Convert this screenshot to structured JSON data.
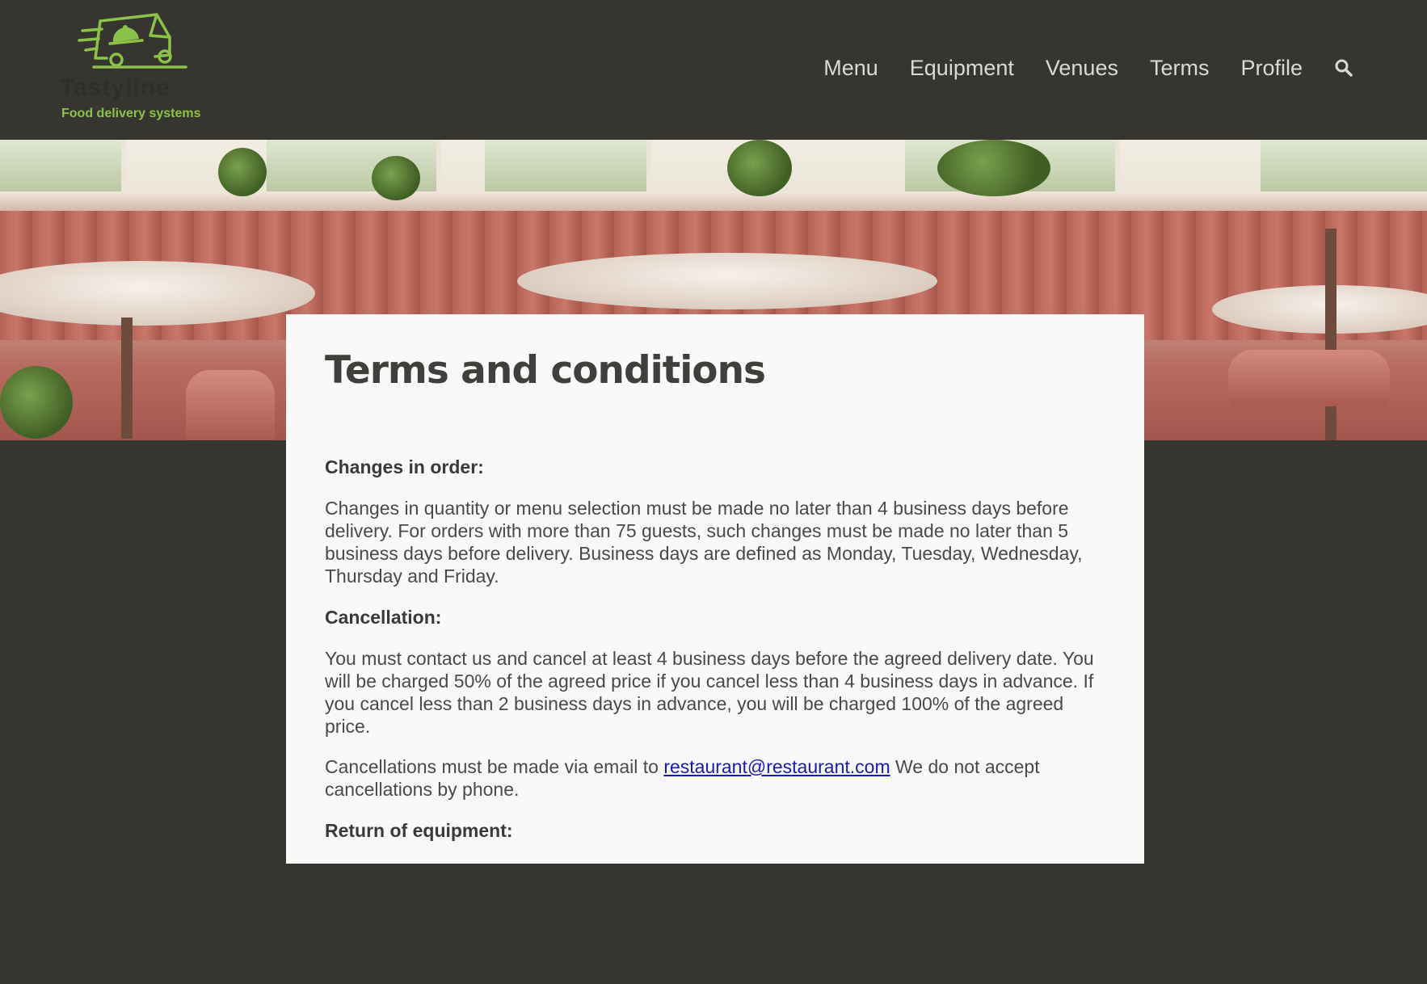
{
  "header": {
    "logo": {
      "wordmark": "Tastyline",
      "tagline": "Food delivery systems",
      "icon": "delivery-truck-cloche-icon",
      "accent_color": "#8bc34a"
    },
    "nav": [
      {
        "label": "Menu"
      },
      {
        "label": "Equipment"
      },
      {
        "label": "Venues"
      },
      {
        "label": "Terms"
      },
      {
        "label": "Profile"
      }
    ],
    "search_icon": "search-icon",
    "background_color": "#37352f"
  },
  "hero": {
    "image": "restaurant-interior-photo"
  },
  "content": {
    "title": "Terms and conditions",
    "sections": [
      {
        "heading": "Changes in order:",
        "paragraphs": [
          "Changes in quantity or menu selection must be made no later than 4 business days before delivery. For orders with more than 75 guests, such changes must be made no later than 5 business days before delivery. Business days are defined as Monday, Tuesday, Wednesday, Thursday and Friday."
        ]
      },
      {
        "heading": "Cancellation:",
        "paragraphs": [
          "You must contact us and cancel at least 4 business days before the agreed delivery date. You will be charged 50% of the agreed price if you cancel less than 4 business days in advance. If you cancel less than 2 business days in advance, you will be charged 100% of the agreed price."
        ],
        "email_paragraph": {
          "before": "Cancellations must be made via email to ",
          "email": "restaurant@restaurant.com",
          "after": " We do not accept cancellations by phone."
        }
      },
      {
        "heading": "Return of equipment:"
      }
    ],
    "link_color": "#1a1ab8"
  }
}
